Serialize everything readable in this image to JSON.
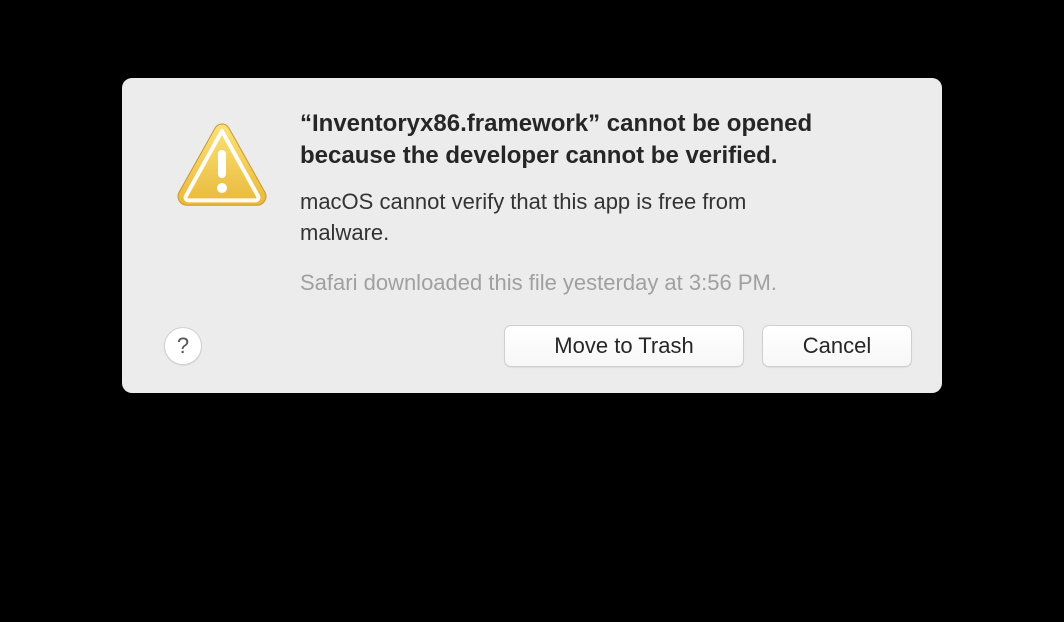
{
  "dialog": {
    "heading": "“Inventoryx86.framework” cannot be opened because the developer cannot be verified.",
    "subtext": "macOS cannot verify that this app is free from malware.",
    "detail": "Safari downloaded this file yesterday at 3:56 PM.",
    "help_label": "?",
    "move_to_trash_label": "Move to Trash",
    "cancel_label": "Cancel"
  }
}
